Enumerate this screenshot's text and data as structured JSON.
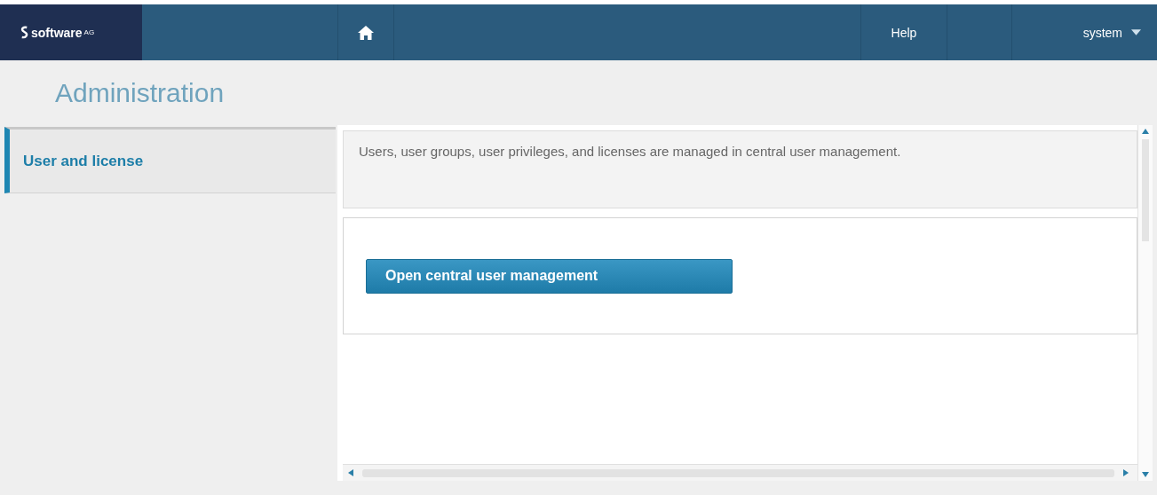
{
  "header": {
    "logo": {
      "text": "software",
      "suffix": "AG"
    },
    "nav": [
      {
        "kind": "home"
      },
      {
        "kind": "text",
        "label": "Help"
      }
    ],
    "user": {
      "label": "system"
    }
  },
  "page_title": "Administration",
  "sidebar": {
    "items": [
      {
        "label": "User and license",
        "selected": true
      }
    ]
  },
  "content": {
    "info": "Users, user groups, user privileges, and licenses are managed in central user management.",
    "button": "Open central user management"
  }
}
